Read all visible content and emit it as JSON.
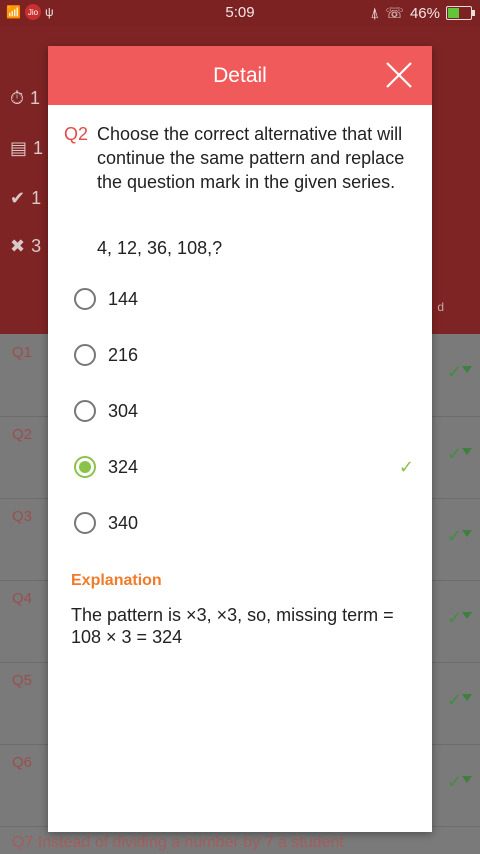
{
  "status_bar": {
    "carrier": "Jio",
    "time": "5:09",
    "battery": "46%",
    "battery_level": 0.46
  },
  "background": {
    "stats": [
      "1",
      "1",
      "1",
      "3"
    ],
    "side_text": "d",
    "rows": [
      {
        "label": "Q1"
      },
      {
        "label": "Q2"
      },
      {
        "label": "Q3"
      },
      {
        "label": "Q4"
      },
      {
        "label": "Q5"
      },
      {
        "label": "Q6"
      }
    ],
    "bottom_row": "Q7 Instead of dividing a number by 7 a student"
  },
  "dialog": {
    "title": "Detail",
    "question_label": "Q2",
    "question_text": "Choose the correct alternative that will continue the same pattern and replace the question mark in the given series.",
    "series": "4, 12, 36, 108,?",
    "options": [
      {
        "label": "144",
        "selected": false,
        "correct": false
      },
      {
        "label": "216",
        "selected": false,
        "correct": false
      },
      {
        "label": "304",
        "selected": false,
        "correct": false
      },
      {
        "label": "324",
        "selected": true,
        "correct": true
      },
      {
        "label": "340",
        "selected": false,
        "correct": false
      }
    ],
    "correct_mark": "✓",
    "explanation_title": "Explanation",
    "explanation_text": "The pattern is ×3, ×3, so, missing term = 108 × 3 = 324"
  },
  "colors": {
    "header": "#f05a5a",
    "accent": "#8bc34a",
    "explanation": "#f07b2a"
  }
}
